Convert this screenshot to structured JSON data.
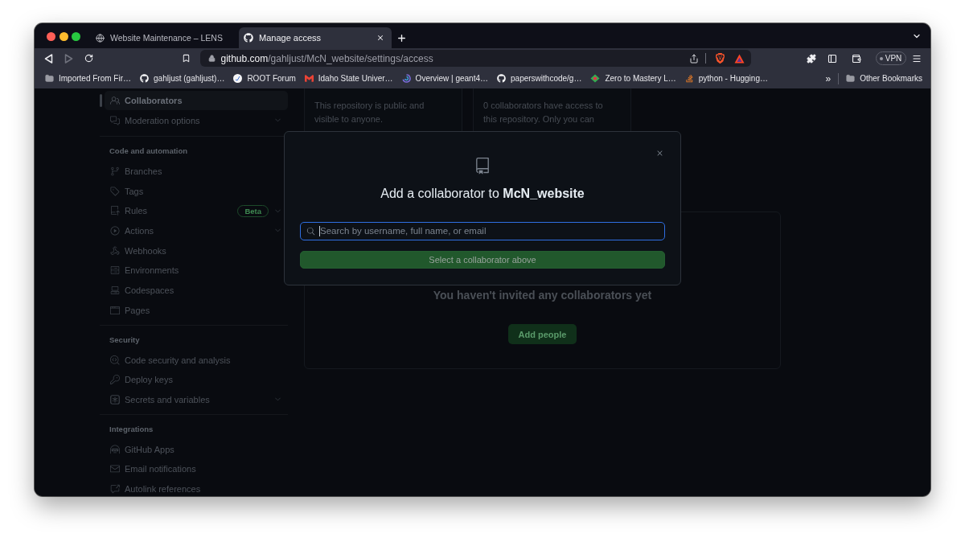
{
  "browser": {
    "tabs": [
      {
        "title": "Website Maintenance – LENS",
        "selected": false
      },
      {
        "title": "Manage access",
        "selected": true
      }
    ],
    "address": {
      "host": "github.com",
      "path": "/gahljust/McN_website/settings/access"
    },
    "vpn": {
      "label": "VPN"
    },
    "bookmarks": [
      {
        "label": "Imported From Fir…"
      },
      {
        "label": "gahljust (gahljust)…"
      },
      {
        "label": "ROOT Forum"
      },
      {
        "label": "Idaho State Univer…"
      },
      {
        "label": "Overview | geant4…"
      },
      {
        "label": "paperswithcode/g…"
      },
      {
        "label": "Zero to Mastery L…"
      },
      {
        "label": "python - Hugging…"
      }
    ],
    "overflow": "»",
    "other_bookmarks": {
      "label": "Other Bookmarks"
    }
  },
  "sidebar": {
    "sections": [
      {
        "items": [
          {
            "label": "Collaborators",
            "selected": true,
            "expandable": false
          },
          {
            "label": "Moderation options",
            "selected": false,
            "expandable": true
          }
        ]
      },
      {
        "heading": "Code and automation",
        "items": [
          {
            "label": "Branches",
            "selected": false,
            "expandable": false
          },
          {
            "label": "Tags",
            "selected": false,
            "expandable": false
          },
          {
            "label": "Rules",
            "selected": false,
            "expandable": true,
            "badge": "Beta"
          },
          {
            "label": "Actions",
            "selected": false,
            "expandable": true
          },
          {
            "label": "Webhooks",
            "selected": false,
            "expandable": false
          },
          {
            "label": "Environments",
            "selected": false,
            "expandable": false
          },
          {
            "label": "Codespaces",
            "selected": false,
            "expandable": false
          },
          {
            "label": "Pages",
            "selected": false,
            "expandable": false
          }
        ]
      },
      {
        "heading": "Security",
        "items": [
          {
            "label": "Code security and analysis",
            "selected": false,
            "expandable": false
          },
          {
            "label": "Deploy keys",
            "selected": false,
            "expandable": false
          },
          {
            "label": "Secrets and variables",
            "selected": false,
            "expandable": true
          }
        ]
      },
      {
        "heading": "Integrations",
        "items": [
          {
            "label": "GitHub Apps",
            "selected": false,
            "expandable": false
          },
          {
            "label": "Email notifications",
            "selected": false,
            "expandable": false
          },
          {
            "label": "Autolink references",
            "selected": false,
            "expandable": false
          }
        ]
      }
    ]
  },
  "main": {
    "cards": [
      {
        "text": "This repository is public and visible to anyone."
      },
      {
        "text": "0 collaborators have access to this repository. Only you can"
      }
    ],
    "empty_state": {
      "message": "You haven't invited any collaborators yet",
      "button": "Add people"
    }
  },
  "dialog": {
    "title": "Add a collaborator to **McN_website**",
    "search": {
      "placeholder": "Search by username, full name, or email"
    },
    "submit": {
      "label": "Select a collaborator above",
      "disabled": true
    }
  }
}
